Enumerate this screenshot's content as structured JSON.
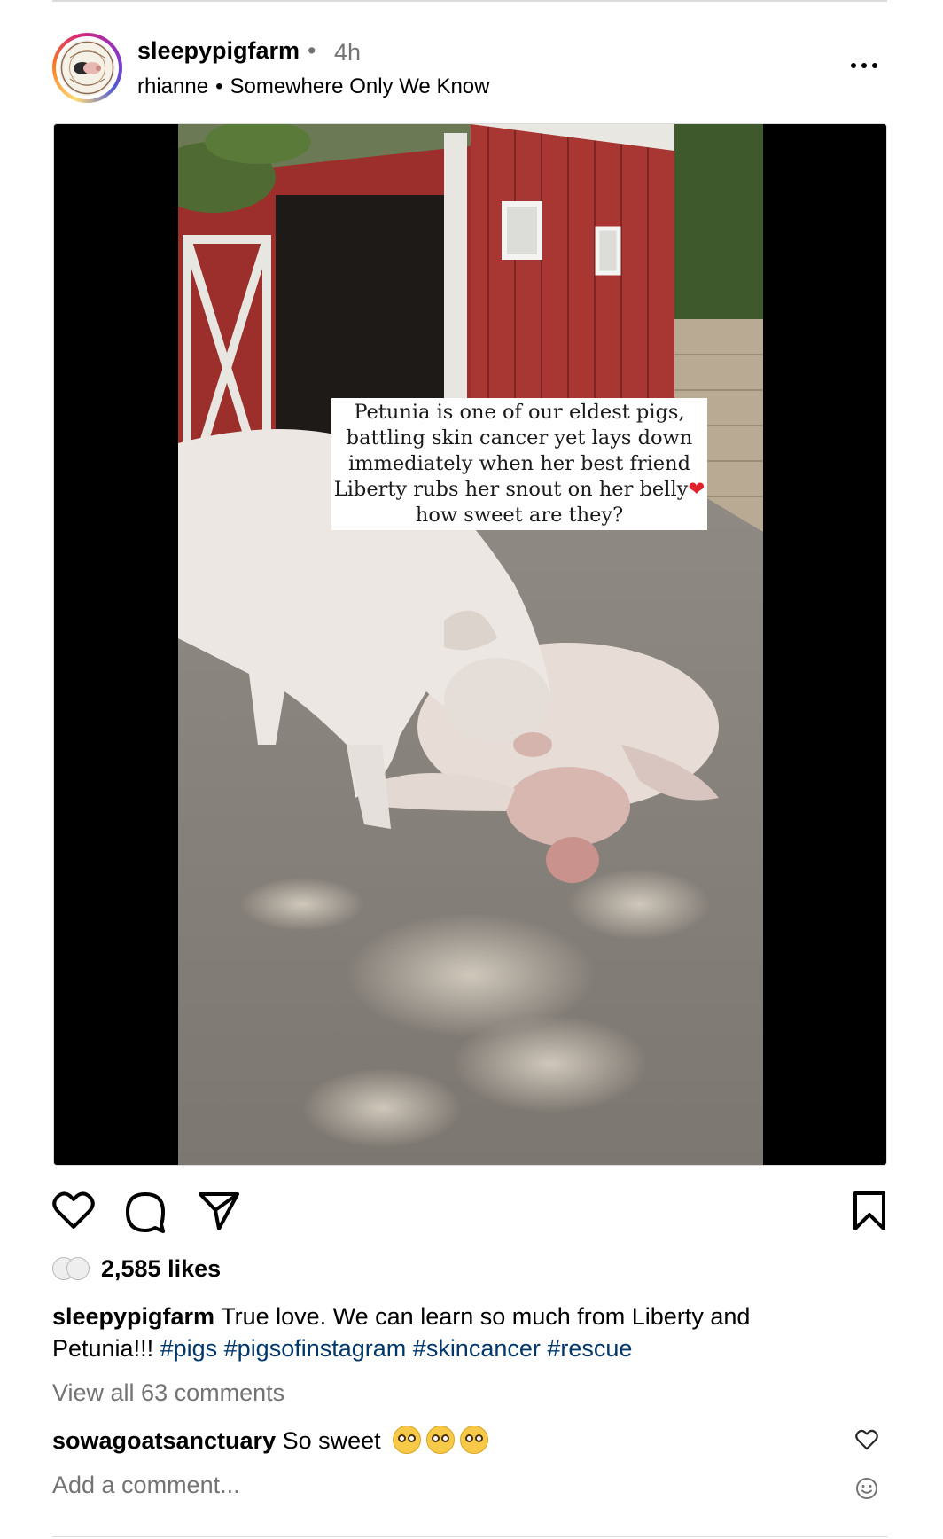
{
  "post": {
    "author": "sleepypigfarm",
    "separator": "•",
    "time": "4h",
    "audio_artist": "rhianne",
    "audio_bullet": "•",
    "audio_track": "Somewhere Only We Know"
  },
  "media": {
    "overlay_lines": [
      "Petunia is one of our eldest pigs,",
      "battling skin cancer yet lays down",
      "immediately when her best friend",
      "Liberty rubs her snout on her belly",
      "how sweet are they?"
    ],
    "overlay_heart": "❤"
  },
  "icons": {
    "more": "more-options-icon",
    "mute": "muted-speaker-icon",
    "like": "heart-icon",
    "comment": "comment-bubble-icon",
    "share": "paper-plane-icon",
    "save": "bookmark-icon",
    "emoji": "smiley-icon"
  },
  "engagement": {
    "likes": "2,585 likes"
  },
  "caption": {
    "username": "sleepypigfarm",
    "text": "True love. We can learn so much from Liberty and Petunia!!!",
    "hashtags": [
      "#pigs",
      "#pigsofinstagram",
      "#skincancer",
      "#rescue"
    ]
  },
  "comments": {
    "view_all": "View all 63 comments",
    "items": [
      {
        "username": "sowagoatsanctuary",
        "text": "So sweet"
      }
    ]
  },
  "add_comment": {
    "placeholder": "Add a comment..."
  },
  "colors": {
    "link": "#00376b",
    "muted": "#737373",
    "divider": "#dbdbdb"
  }
}
